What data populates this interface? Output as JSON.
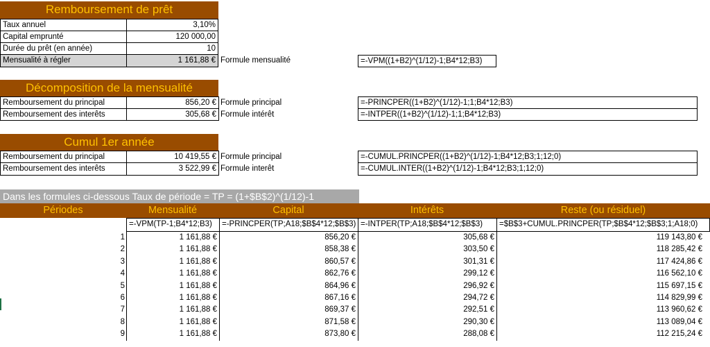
{
  "sheet": {
    "title_loan": "Remboursement de prêt",
    "inputs": [
      {
        "label": "Taux annuel",
        "value": "3,10%"
      },
      {
        "label": "Capital emprunté",
        "value": "120 000,00"
      },
      {
        "label": "Durée du prêt (en année)",
        "value": "10"
      },
      {
        "label": "Mensualité à régler",
        "value": "1 161,88 €",
        "formula_label": "Formule mensualité",
        "formula": "=-VPM((1+B2)^(1/12)-1;B4*12;B3)"
      }
    ],
    "title_decomp": "Décomposition de la mensualité",
    "decomp": [
      {
        "label": "Remboursement du principal",
        "value": "856,20 €",
        "formula_label": "Formule principal",
        "formula": "=-PRINCPER((1+B2)^(1/12)-1;1;B4*12;B3)"
      },
      {
        "label": "Remboursement des interêts",
        "value": "305,68 €",
        "formula_label": "Formule intérêt",
        "formula": "=-INTPER((1+B2)^(1/12)-1;1;B4*12;B3)"
      }
    ],
    "title_cumul": "Cumul 1er année",
    "cumul": [
      {
        "label": "Remboursement du principal",
        "value": "10 419,55 €",
        "formula_label": "Formule principal",
        "formula": "=-CUMUL.PRINCPER((1+B2)^(1/12)-1;B4*12;B3;1;12;0)"
      },
      {
        "label": "Remboursement des interêts",
        "value": "3 522,99 €",
        "formula_label": "Formule interêt",
        "formula": "=-CUMUL.INTER((1+B2)^(1/12)-1;B4*12;B3;1;12;0)"
      }
    ],
    "note": "Dans les formules ci-dessous Taux de période = TP =  (1+$B$2)^(1/12)-1",
    "table_headers": [
      "Périodes",
      "Mensualité",
      "Capital",
      "Intérêts",
      "Reste (ou résiduel)"
    ],
    "table_formulas": [
      "",
      "=-VPM(TP-1;B4*12;B3)",
      "=-PRINCPER(TP;A18;$B$4*12;$B$3)",
      "=-INTPER(TP;A18;$B$4*12;$B$3)",
      "=$B$3+CUMUL.PRINCPER(TP;$B$4*12;$B$3;1;A18;0)"
    ],
    "rows": [
      [
        "1",
        "1 161,88 €",
        "856,20 €",
        "305,68 €",
        "119 143,80 €"
      ],
      [
        "2",
        "1 161,88 €",
        "858,38 €",
        "303,50 €",
        "118 285,42 €"
      ],
      [
        "3",
        "1 161,88 €",
        "860,57 €",
        "301,31 €",
        "117 424,86 €"
      ],
      [
        "4",
        "1 161,88 €",
        "862,76 €",
        "299,12 €",
        "116 562,10 €"
      ],
      [
        "5",
        "1 161,88 €",
        "864,96 €",
        "296,92 €",
        "115 697,15 €"
      ],
      [
        "6",
        "1 161,88 €",
        "867,16 €",
        "294,72 €",
        "114 829,99 €"
      ],
      [
        "7",
        "1 161,88 €",
        "869,37 €",
        "292,51 €",
        "113 960,62 €"
      ],
      [
        "8",
        "1 161,88 €",
        "871,58 €",
        "290,30 €",
        "113 089,04 €"
      ],
      [
        "9",
        "1 161,88 €",
        "873,80 €",
        "288,08 €",
        "112 215,24 €"
      ]
    ]
  },
  "colors": {
    "banner_bg": "#994c00",
    "banner_text": "#ffc000",
    "note_bg": "#a8a8a8",
    "highlight": "#d4d4d4"
  }
}
